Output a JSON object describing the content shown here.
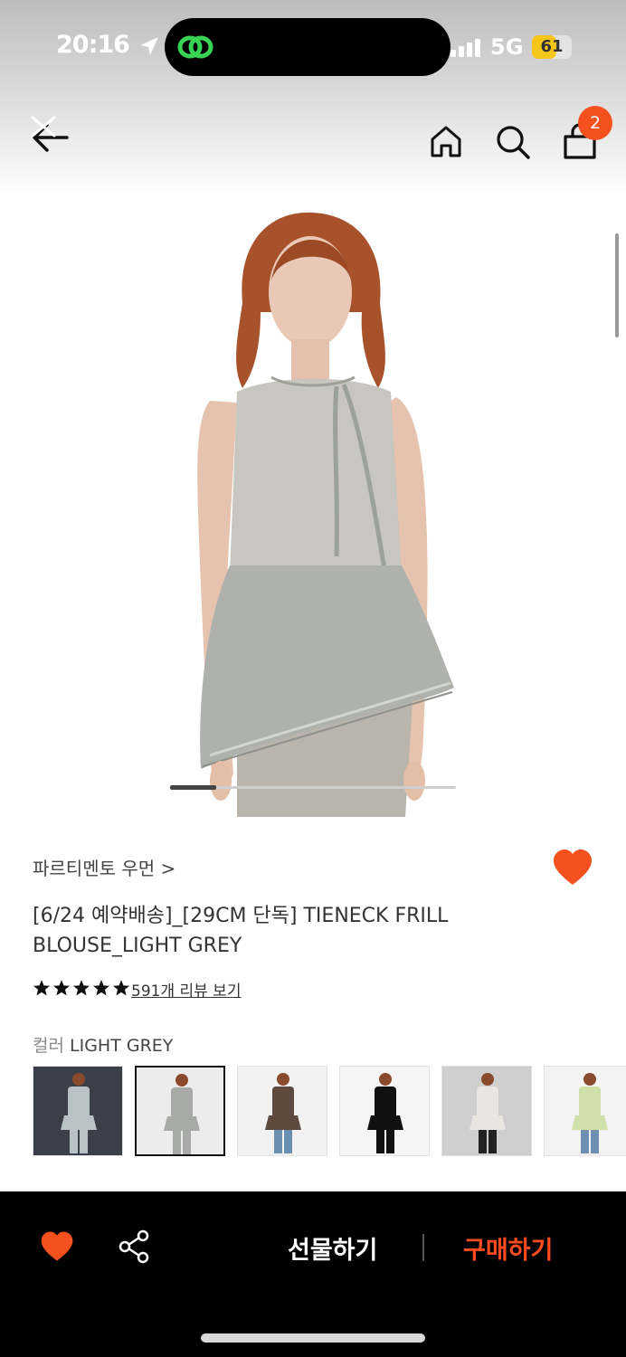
{
  "status_bar": {
    "time": "20:16",
    "network": "5G",
    "battery": "61",
    "battery_level": 0.61
  },
  "header": {
    "cart_count": "2"
  },
  "product": {
    "brand": "파르티멘토 우먼 >",
    "title": "[6/24 예약배송]_[29CM 단독] TIENECK FRILL BLOUSE_LIGHT GREY",
    "rating": 5,
    "review_link": "591개 리뷰 보기",
    "color_label": "컬러",
    "color_value": "LIGHT GREY",
    "image_count_progress": 0.16
  },
  "swatches": [
    {
      "name": "swatch-1",
      "bg": "#3b3f4a",
      "top": "#b9c2c6",
      "bottom": "#b9c2c6"
    },
    {
      "name": "swatch-2",
      "bg": "#ececec",
      "top": "#a7aaa6",
      "bottom": "#a7aaa6"
    },
    {
      "name": "swatch-3",
      "bg": "#f2f2f2",
      "top": "#5e4a3f",
      "bottom": "#6a8fb0"
    },
    {
      "name": "swatch-4",
      "bg": "#f5f5f5",
      "top": "#111111",
      "bottom": "#111111"
    },
    {
      "name": "swatch-5",
      "bg": "#cfcfcf",
      "top": "#e9e6e2",
      "bottom": "#222222"
    },
    {
      "name": "swatch-6",
      "bg": "#f3f3f3",
      "top": "#cfe0a8",
      "bottom": "#6f8fb2"
    }
  ],
  "bottom_bar": {
    "gift_label": "선물하기",
    "buy_label": "구매하기"
  },
  "colors": {
    "accent": "#f4511e",
    "buy": "#ff4b1f"
  }
}
